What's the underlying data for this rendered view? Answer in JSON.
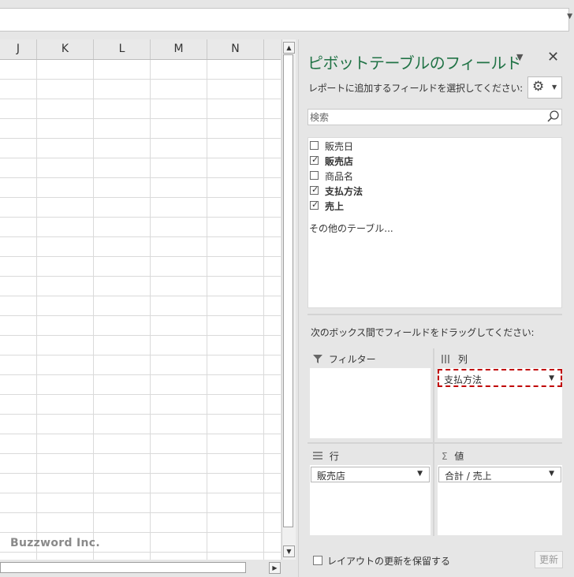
{
  "sheet": {
    "columns": [
      "J",
      "K",
      "L",
      "M",
      "N"
    ],
    "watermark": "Buzzword Inc."
  },
  "pivot_panel": {
    "title": "ピボットテーブルのフィールド",
    "choose_fields_label": "レポートに追加するフィールドを選択してください:",
    "search_placeholder": "検索",
    "fields": [
      {
        "label": "販売日",
        "checked": false
      },
      {
        "label": "販売店",
        "checked": true
      },
      {
        "label": "商品名",
        "checked": false
      },
      {
        "label": "支払方法",
        "checked": true
      },
      {
        "label": "売上",
        "checked": true
      }
    ],
    "more_tables": "その他のテーブル...",
    "drag_label": "次のボックス間でフィールドをドラッグしてください:",
    "areas": {
      "filter": {
        "title": "フィルター",
        "items": []
      },
      "columns": {
        "title": "列",
        "items": [
          "支払方法"
        ]
      },
      "rows": {
        "title": "行",
        "items": [
          "販売店"
        ]
      },
      "values": {
        "title": "値",
        "items": [
          "合計 / 売上"
        ]
      }
    },
    "defer_update_label": "レイアウトの更新を保留する",
    "update_button": "更新"
  },
  "icons": {
    "panel_menu": "chevron-down-icon",
    "close": "close-icon",
    "settings": "gear-icon",
    "search": "search-icon",
    "filter": "filter-icon",
    "columns": "columns-icon",
    "rows": "rows-icon",
    "values": "sigma-icon"
  },
  "colors": {
    "title_green": "#217346",
    "highlight_red": "#c00000"
  }
}
